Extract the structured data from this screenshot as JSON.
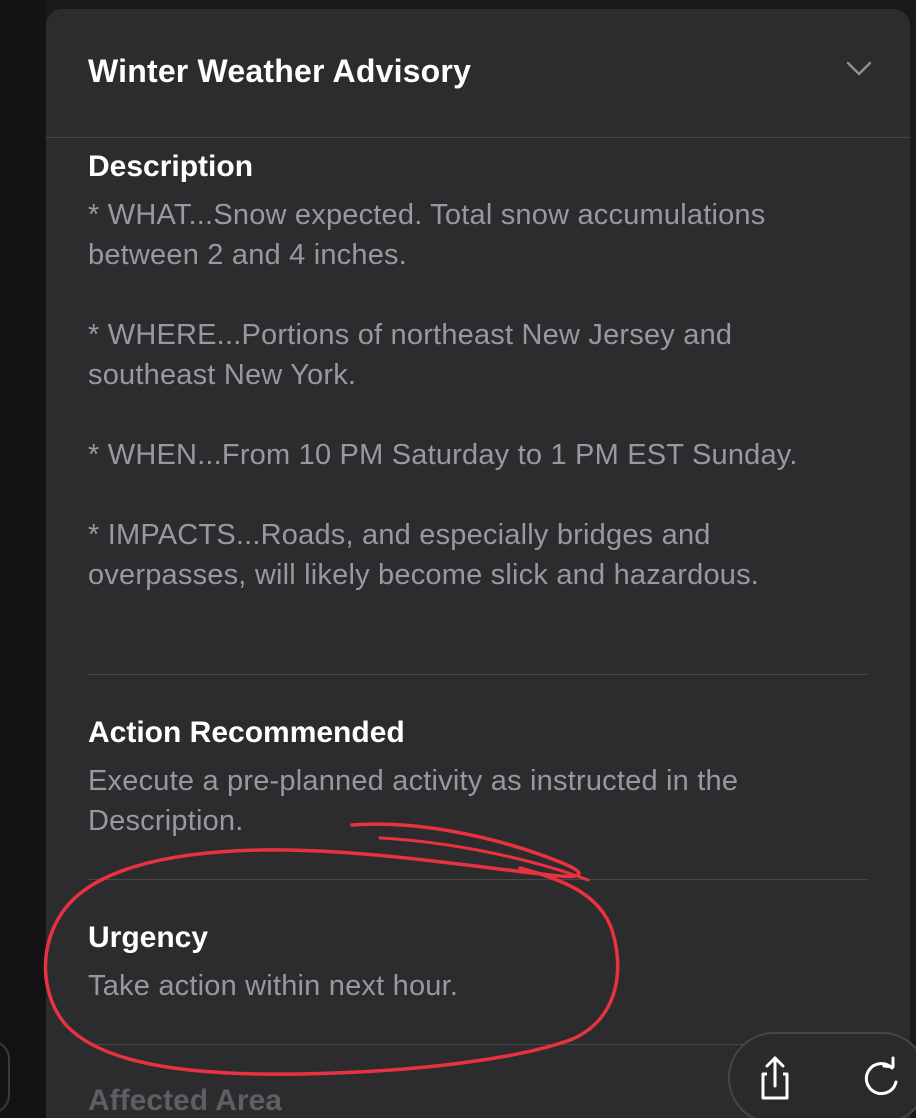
{
  "alert": {
    "title": "Winter Weather Advisory",
    "expand_icon": "chevron-down-icon"
  },
  "sections": {
    "description": {
      "heading": "Description",
      "paragraphs": [
        "* WHAT...Snow expected. Total snow accumulations between 2 and 4 inches.",
        "* WHERE...Portions of northeast New Jersey and southeast New York.",
        "* WHEN...From 10 PM Saturday to 1 PM EST Sunday.",
        "* IMPACTS...Roads, and especially bridges and overpasses, will likely become slick and hazardous."
      ]
    },
    "action": {
      "heading": "Action Recommended",
      "body": "Execute a pre-planned activity as instructed in the Description."
    },
    "urgency": {
      "heading": "Urgency",
      "body": "Take action within next hour."
    },
    "affected_area": {
      "heading": "Affected Area"
    }
  },
  "toolbar": {
    "share_icon": "share-icon",
    "refresh_icon": "refresh-icon"
  },
  "colors": {
    "card_background": "#2c2c2e",
    "heading_text": "#ffffff",
    "body_text": "#98989e",
    "annotation_stroke": "#e8323f"
  }
}
